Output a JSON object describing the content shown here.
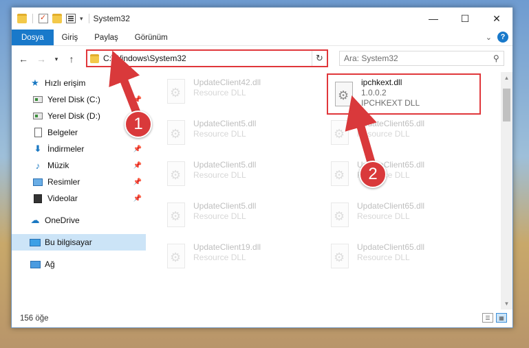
{
  "window": {
    "title": "System32",
    "controls": {
      "minimize": "—",
      "maximize": "☐",
      "close": "✕"
    }
  },
  "ribbon": {
    "tabs": [
      "Dosya",
      "Giriş",
      "Paylaş",
      "Görünüm"
    ],
    "help": "?"
  },
  "navbar": {
    "address": "C:\\Windows\\System32",
    "search_placeholder": "Ara: System32"
  },
  "sidebar": {
    "quick_access": "Hızlı erişim",
    "items": [
      {
        "label": "Yerel Disk (C:)",
        "icon": "drive-icon",
        "pinned": true
      },
      {
        "label": "Yerel Disk (D:)",
        "icon": "drive-icon",
        "pinned": false
      },
      {
        "label": "Belgeler",
        "icon": "documents-icon",
        "pinned": true
      },
      {
        "label": "İndirmeler",
        "icon": "downloads-icon",
        "pinned": true
      },
      {
        "label": "Müzik",
        "icon": "music-icon",
        "pinned": true
      },
      {
        "label": "Resimler",
        "icon": "pictures-icon",
        "pinned": true
      },
      {
        "label": "Videolar",
        "icon": "videos-icon",
        "pinned": true
      }
    ],
    "onedrive": "OneDrive",
    "this_pc": "Bu bilgisayar",
    "network": "Ağ"
  },
  "files": {
    "left_column": [
      {
        "name": "UpdateClient42.dll",
        "type": "Resource DLL"
      },
      {
        "name": "UpdateClient5.dll",
        "type": "Resource DLL"
      },
      {
        "name": "UpdateClient5.dll",
        "type": "Resource DLL"
      },
      {
        "name": "UpdateClient5.dll",
        "type": "Resource DLL"
      },
      {
        "name": "UpdateClient19.dll",
        "type": "Resource DLL"
      }
    ],
    "highlighted": {
      "name": "ipchkext.dll",
      "version": "1.0.0.2",
      "description": "IPCHKEXT DLL"
    },
    "right_column": [
      {
        "name": "UpdateClient65.dll",
        "type": "Resource DLL"
      },
      {
        "name": "UpdateClient65.dll",
        "type": "Resource DLL"
      },
      {
        "name": "UpdateClient65.dll",
        "type": "Resource DLL"
      },
      {
        "name": "UpdateClient65.dll",
        "type": "Resource DLL"
      }
    ]
  },
  "status": {
    "item_count": "156 öğe"
  },
  "annotations": {
    "step1": "1",
    "step2": "2",
    "color": "#d9393b"
  }
}
